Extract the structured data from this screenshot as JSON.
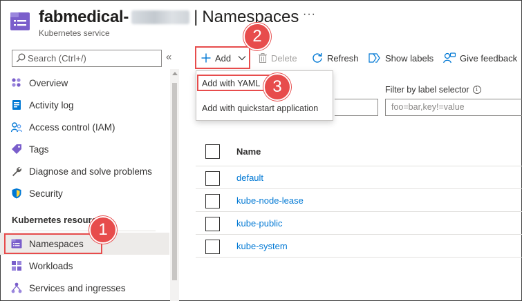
{
  "header": {
    "resource_name": "fabmedical-",
    "separator": "|",
    "page_title": "Namespaces",
    "more": "···",
    "subtitle": "Kubernetes service"
  },
  "sidebar": {
    "search_placeholder": "Search (Ctrl+/)",
    "collapse": "«",
    "items": [
      {
        "label": "Overview",
        "icon": "overview-icon"
      },
      {
        "label": "Activity log",
        "icon": "activity-log-icon"
      },
      {
        "label": "Access control (IAM)",
        "icon": "iam-icon"
      },
      {
        "label": "Tags",
        "icon": "tag-icon"
      },
      {
        "label": "Diagnose and solve problems",
        "icon": "wrench-icon"
      },
      {
        "label": "Security",
        "icon": "shield-icon"
      }
    ],
    "section_title": "Kubernetes resources",
    "k8s_items": [
      {
        "label": "Namespaces",
        "icon": "namespaces-icon",
        "selected": true
      },
      {
        "label": "Workloads",
        "icon": "workloads-icon"
      },
      {
        "label": "Services and ingresses",
        "icon": "services-icon"
      }
    ]
  },
  "toolbar": {
    "add": "Add",
    "delete": "Delete",
    "refresh": "Refresh",
    "show_labels": "Show labels",
    "give_feedback": "Give feedback"
  },
  "add_menu": {
    "items": [
      "Add with YAML",
      "Add with quickstart application"
    ]
  },
  "filters": {
    "label_selector_label": "Filter by label selector",
    "label_selector_placeholder": "foo=bar,key!=value"
  },
  "table": {
    "header": "Name",
    "rows": [
      "default",
      "kube-node-lease",
      "kube-public",
      "kube-system"
    ]
  },
  "callouts": [
    "1",
    "2",
    "3"
  ],
  "colors": {
    "accent": "#0078d4",
    "highlight": "#e74c4c",
    "selected_bg": "#edebe9",
    "resource_icon": "#7a5ecb"
  }
}
